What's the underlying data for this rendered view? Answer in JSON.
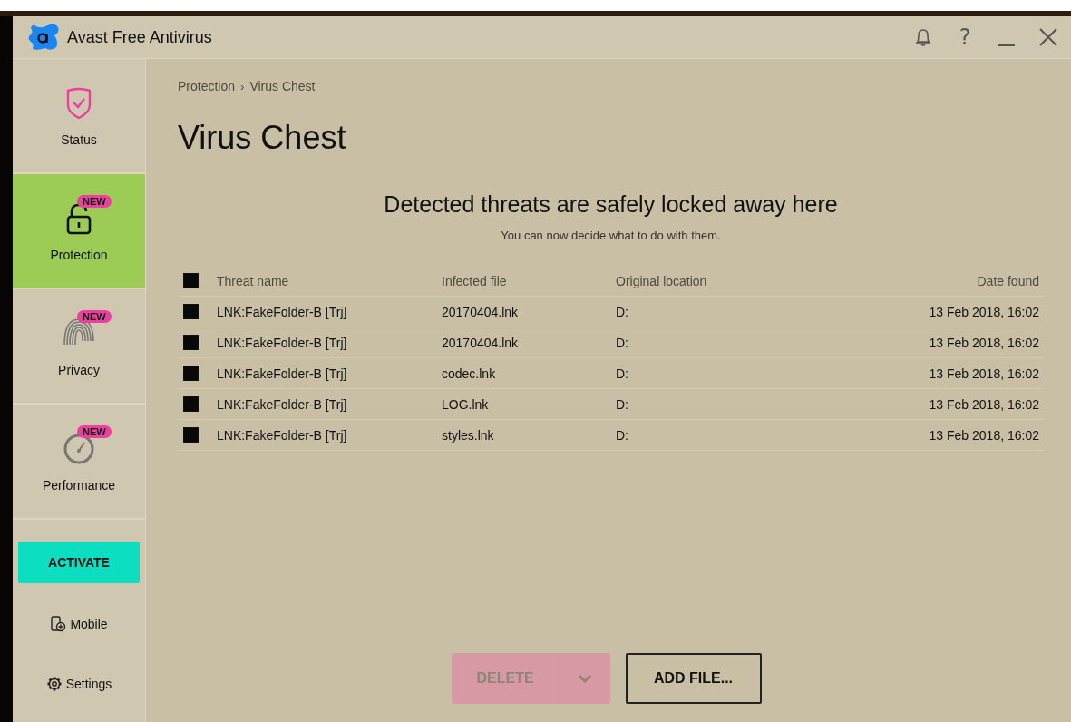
{
  "window": {
    "title": "Avast Free Antivirus"
  },
  "title_bar_buttons": [
    {
      "kind": "bell"
    },
    {
      "kind": "help",
      "label": "?"
    },
    {
      "kind": "minimize"
    },
    {
      "kind": "close"
    }
  ],
  "sidebar": {
    "items": [
      {
        "kind": "status",
        "label": "Status",
        "selected": false
      },
      {
        "kind": "protection",
        "label": "Protection",
        "selected": true,
        "badge": "NEW"
      },
      {
        "kind": "privacy",
        "label": "Privacy",
        "selected": false,
        "badge": "NEW"
      },
      {
        "kind": "performance",
        "label": "Performance",
        "selected": false,
        "badge": "NEW"
      }
    ],
    "activate_button": "ACTIVATE",
    "links": [
      {
        "kind": "mobile",
        "label": "Mobile"
      },
      {
        "kind": "settings",
        "label": "Settings"
      }
    ]
  },
  "breadcrumb": {
    "items": [
      "Protection",
      "Virus Chest"
    ],
    "separator": "›"
  },
  "title": "Virus Chest",
  "heading": "Detected threats are safely locked away here",
  "subheading": "You can now decide what to do with them.",
  "table": {
    "select_all": {
      "checked": false
    },
    "columns": [
      "Threat name",
      "Infected file",
      "Original location",
      "Date found"
    ],
    "rows": [
      {
        "checked": false,
        "cells": [
          "LNK:FakeFolder-B [Trj]",
          "20170404.lnk",
          "D:",
          "13 Feb 2018, 16:02"
        ]
      },
      {
        "checked": false,
        "cells": [
          "LNK:FakeFolder-B [Trj]",
          "20170404.lnk",
          "D:",
          "13 Feb 2018, 16:02"
        ]
      },
      {
        "checked": false,
        "cells": [
          "LNK:FakeFolder-B [Trj]",
          "codec.lnk",
          "D:",
          "13 Feb 2018, 16:02"
        ]
      },
      {
        "checked": false,
        "cells": [
          "LNK:FakeFolder-B [Trj]",
          "LOG.lnk",
          "D:",
          "13 Feb 2018, 16:02"
        ]
      },
      {
        "checked": false,
        "cells": [
          "LNK:FakeFolder-B [Trj]",
          "styles.lnk",
          "D:",
          "13 Feb 2018, 16:02"
        ]
      }
    ]
  },
  "delete_button": {
    "label": "DELETE",
    "disabled": true
  },
  "add_file_button": {
    "label": "ADD FILE..."
  }
}
